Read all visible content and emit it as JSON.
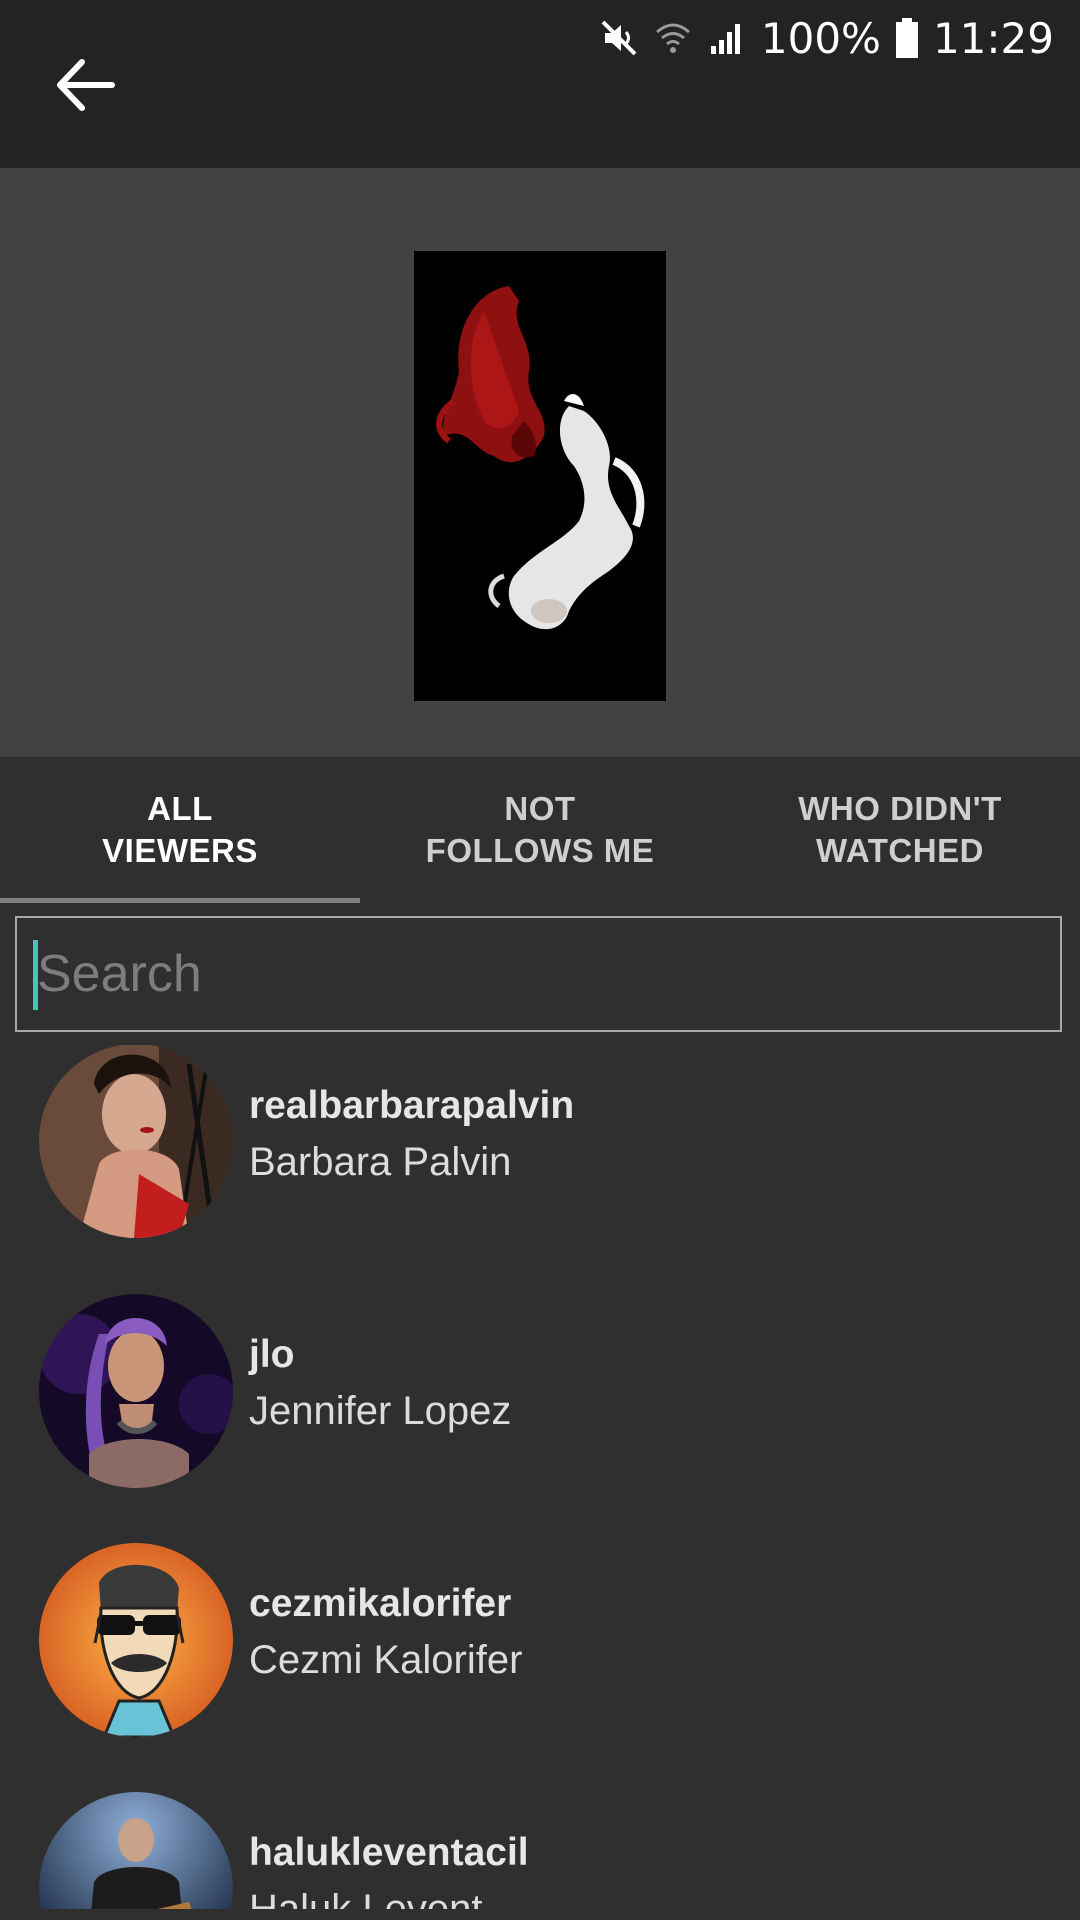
{
  "status_bar": {
    "battery": "100%",
    "time": "11:29",
    "icons": [
      "mute-icon",
      "wifi-icon",
      "signal-icon",
      "battery-icon"
    ]
  },
  "app_bar": {
    "back_icon": "arrow-back-icon"
  },
  "tabs": [
    {
      "line1": "ALL",
      "line2": "VIEWERS",
      "active": true
    },
    {
      "line1": "NOT",
      "line2": "FOLLOWS ME",
      "active": false
    },
    {
      "line1": "WHO DIDN'T",
      "line2": "WATCHED",
      "active": false
    }
  ],
  "search": {
    "placeholder": "Search",
    "value": ""
  },
  "viewers": [
    {
      "username": "realbarbarapalvin",
      "full_name": "Barbara Palvin"
    },
    {
      "username": "jlo",
      "full_name": "Jennifer Lopez"
    },
    {
      "username": "cezmikalorifer",
      "full_name": "Cezmi Kalorifer"
    },
    {
      "username": "halukleventacil",
      "full_name": "Haluk Levent"
    }
  ],
  "colors": {
    "app_bar": "#232323",
    "preview_bg": "#424242",
    "list_bg": "#2f2f2f",
    "accent_caret": "#43c6b4"
  }
}
